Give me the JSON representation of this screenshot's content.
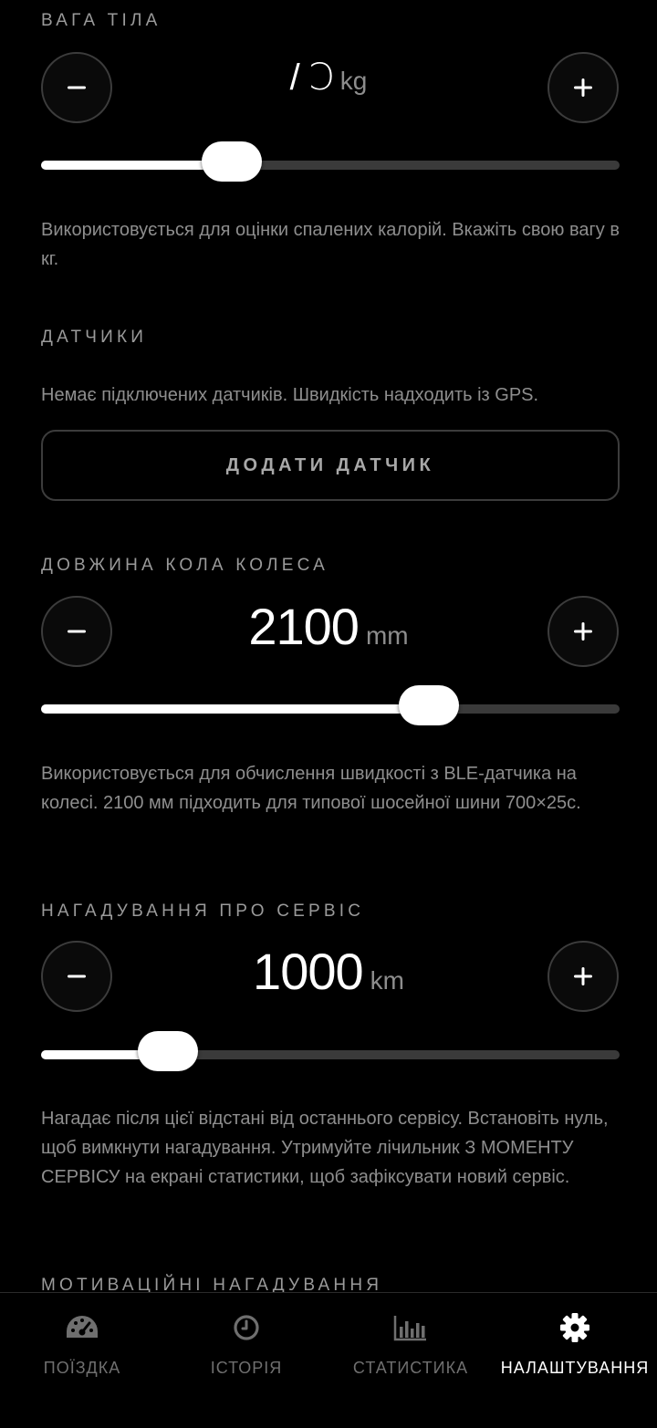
{
  "weight": {
    "title": "ВАГА ТІЛА",
    "value": "/ Ↄ",
    "unit": "kg",
    "slider_fraction": 0.33,
    "description": "Використовується для оцінки спалених калорій. Вкажіть свою вагу в кг."
  },
  "sensors": {
    "title": "ДАТЧИКИ",
    "status": "Немає підключених датчиків. Швидкість надходить із GPS.",
    "add_button": "ДОДАТИ ДАТЧИК"
  },
  "wheel": {
    "title": "ДОВЖИНА КОЛА КОЛЕСА",
    "value": "2100",
    "unit": "mm",
    "slider_fraction": 0.67,
    "description": "Використовується для обчислення швидкості з BLE-датчика на колесі. 2100 мм підходить для типової шосейної шини 700×25c."
  },
  "service": {
    "title": "НАГАДУВАННЯ ПРО СЕРВІС",
    "value": "1000",
    "unit": "km",
    "slider_fraction": 0.22,
    "description": "Нагадає після цієї відстані від останнього сервісу. Встановіть нуль, щоб вимкнути нагадування. Утримуйте лічильник З МОМЕНТУ СЕРВІСУ на екрані статистики, щоб зафіксувати новий сервіс."
  },
  "motivation": {
    "title": "МОТИВАЦІЙНІ НАГАДУВАННЯ"
  },
  "tabs": [
    {
      "label": "ПОЇЗДКА",
      "icon": "speedometer-icon",
      "active": false
    },
    {
      "label": "ІСТОРІЯ",
      "icon": "clock-icon",
      "active": false
    },
    {
      "label": "СТАТИСТИКА",
      "icon": "bar-chart-icon",
      "active": false
    },
    {
      "label": "НАЛАШТУВАННЯ",
      "icon": "gear-icon",
      "active": true
    }
  ],
  "colors": {
    "background": "#000000",
    "accent": "#ffffff",
    "muted_text": "#8e8e8e",
    "track": "#3a3a3a"
  }
}
